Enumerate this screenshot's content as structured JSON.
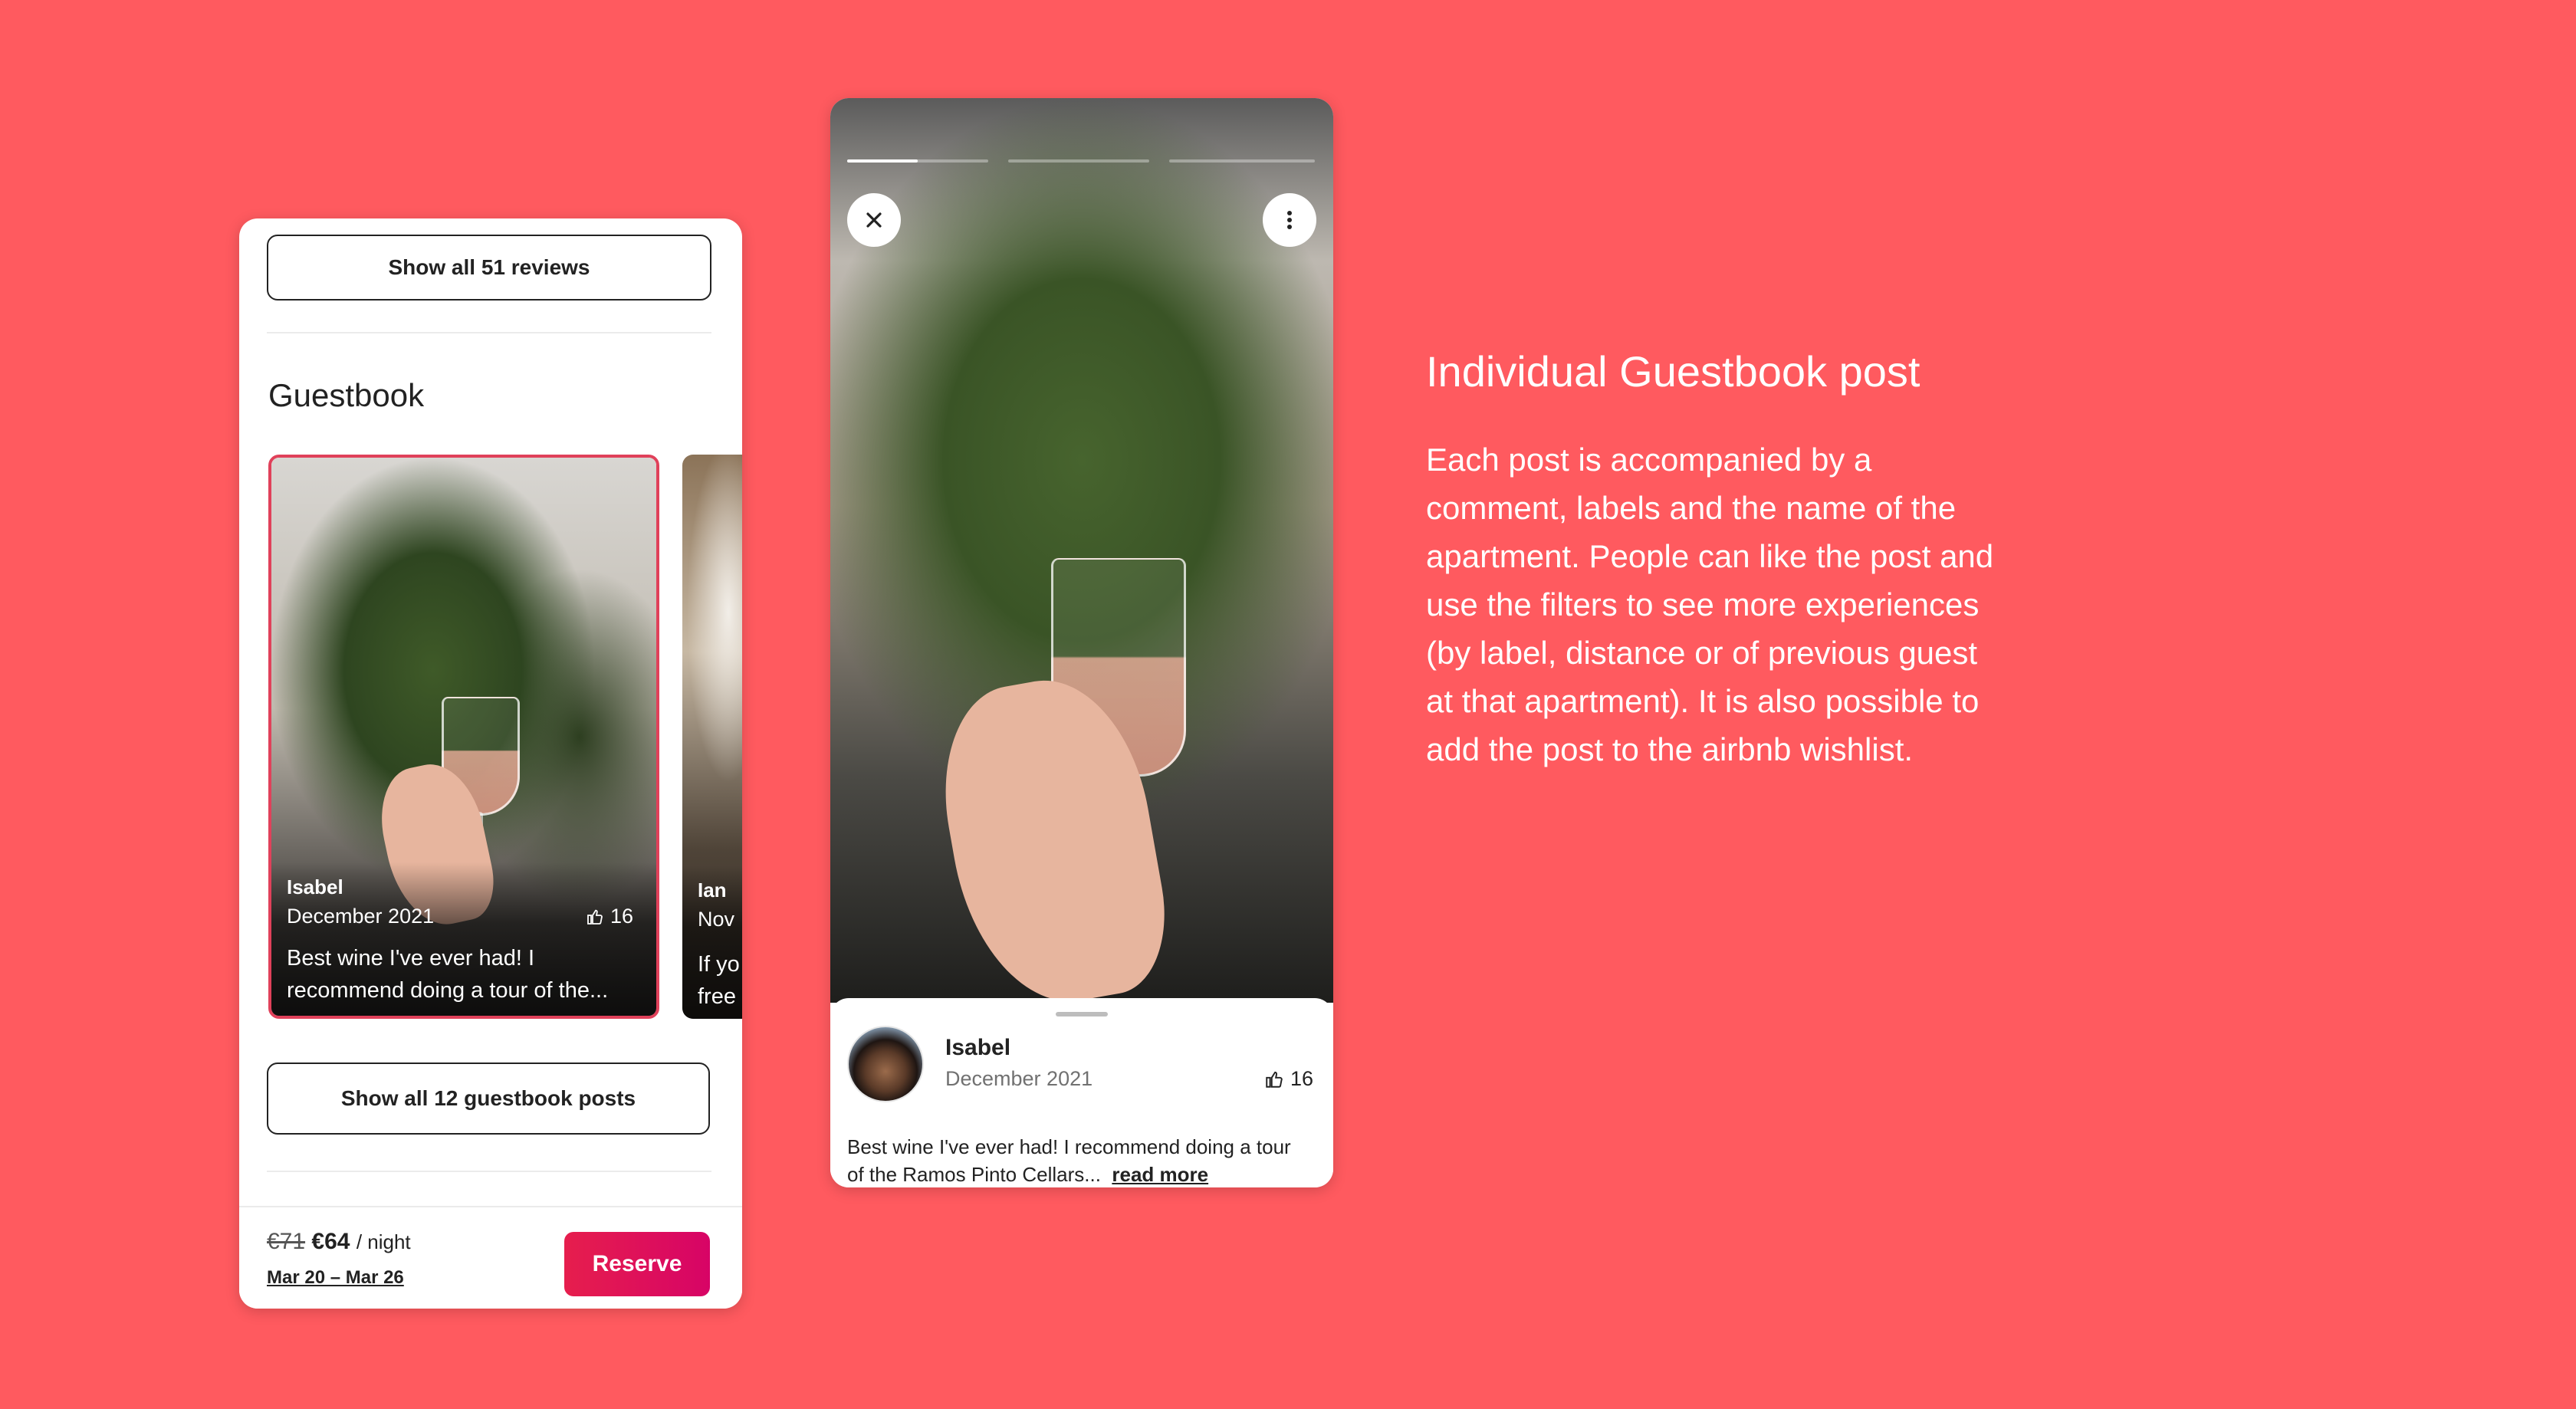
{
  "left_phone": {
    "reviews_button": "Show all 51 reviews",
    "section_title": "Guestbook",
    "card_main": {
      "name": "Isabel",
      "date": "December 2021",
      "likes": "16",
      "comment": "Best wine I've ever had! I recommend doing a tour of the..."
    },
    "card_peek": {
      "name": "Ian",
      "date": "Nov",
      "comment_1": "If yo",
      "comment_2": "free"
    },
    "guestbook_button": "Show all 12 guestbook posts",
    "price_old": "€71",
    "price_new": "€64",
    "price_unit": "/ night",
    "dates": "Mar 20 – Mar 26",
    "reserve": "Reserve"
  },
  "right_phone": {
    "close_icon": "close-icon",
    "more_icon": "more-vertical-icon",
    "progress_segments": [
      0.5,
      0,
      0
    ],
    "name": "Isabel",
    "date": "December 2021",
    "likes": "16",
    "comment": "Best wine I've ever had! I recommend doing a tour of the Ramos Pinto Cellars...",
    "read_more": "read more"
  },
  "description": {
    "heading": "Individual Guestbook post",
    "body": "Each post is accompanied by a comment, labels and the name of the apartment. People can like the post and use the filters to see more experiences (by label, distance or of previous guest at that apartment). It is also possible to add the post to the airbnb wishlist."
  },
  "colors": {
    "background": "#FF5A5F",
    "reserve_gradient_start": "#E61E4D",
    "reserve_gradient_end": "#D70466",
    "selected_card_border": "#E0415A"
  }
}
